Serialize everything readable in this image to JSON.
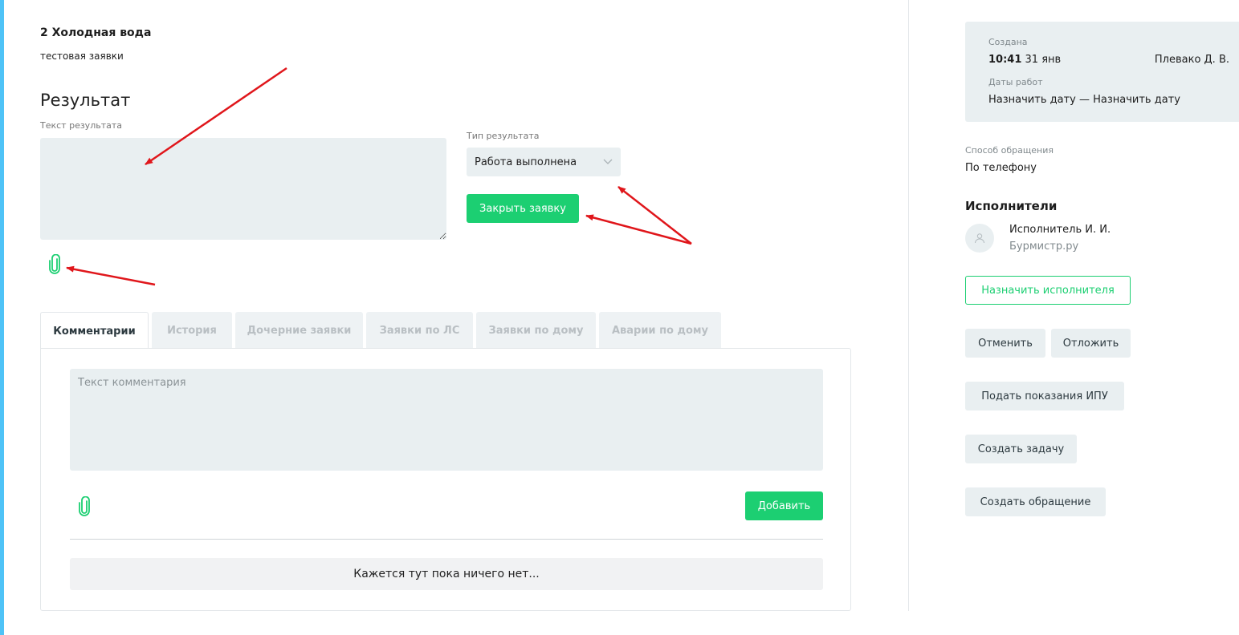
{
  "request": {
    "title": "2 Холодная вода",
    "description": "тестовая заявки"
  },
  "result": {
    "heading": "Результат",
    "text_label": "Текст результата",
    "text_value": "",
    "type_label": "Тип результата",
    "type_selected": "Работа выполнена",
    "close_button": "Закрыть заявку"
  },
  "tabs": [
    {
      "label": "Комментарии",
      "active": true
    },
    {
      "label": "История",
      "active": false
    },
    {
      "label": "Дочерние заявки",
      "active": false
    },
    {
      "label": "Заявки по ЛС",
      "active": false
    },
    {
      "label": "Заявки по дому",
      "active": false
    },
    {
      "label": "Аварии по дому",
      "active": false
    }
  ],
  "comments": {
    "placeholder": "Текст комментария",
    "add_button": "Добавить",
    "empty_text": "Кажется тут пока ничего нет..."
  },
  "sidebar": {
    "created_label": "Создана",
    "created_time": "10:41",
    "created_date": "31 янв",
    "author": "Плевако Д. В.",
    "work_dates_label": "Даты работ",
    "work_dates_value": "Назначить дату — Назначить дату",
    "contact_method_label": "Способ обращения",
    "contact_method_value": "По телефону",
    "executors_heading": "Исполнители",
    "executor_name": "Исполнитель И. И.",
    "executor_company": "Бурмистр.ру",
    "assign_button": "Назначить исполнителя",
    "cancel_button": "Отменить",
    "postpone_button": "Отложить",
    "meter_button": "Подать показания ИПУ",
    "task_button": "Создать задачу",
    "appeal_button": "Создать обращение"
  },
  "colors": {
    "accent_green": "#1ccf72",
    "annotation_red": "#e0161b",
    "field_bg": "#e9eff1"
  },
  "icons": {
    "attach": "paperclip-icon",
    "select": "chevron-down-icon",
    "avatar": "user-icon"
  }
}
